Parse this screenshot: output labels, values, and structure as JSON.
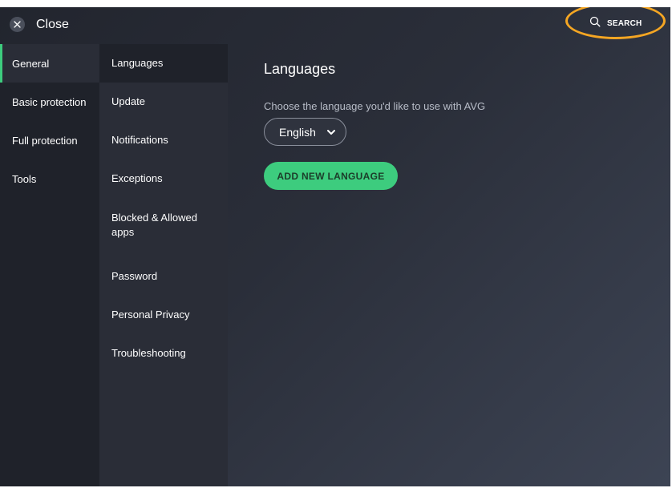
{
  "header": {
    "close_label": "Close",
    "search_label": "SEARCH"
  },
  "nav_primary": {
    "items": [
      {
        "label": "General",
        "active": true
      },
      {
        "label": "Basic protection",
        "active": false
      },
      {
        "label": "Full protection",
        "active": false
      },
      {
        "label": "Tools",
        "active": false
      }
    ]
  },
  "nav_secondary": {
    "items": [
      {
        "label": "Languages",
        "active": true
      },
      {
        "label": "Update",
        "active": false
      },
      {
        "label": "Notifications",
        "active": false
      },
      {
        "label": "Exceptions",
        "active": false
      },
      {
        "label": "Blocked & Allowed apps",
        "active": false
      },
      {
        "label": "Password",
        "active": false
      },
      {
        "label": "Personal Privacy",
        "active": false
      },
      {
        "label": "Troubleshooting",
        "active": false
      }
    ]
  },
  "content": {
    "title": "Languages",
    "description": "Choose the language you'd like to use with AVG",
    "language_select": {
      "selected": "English"
    },
    "add_button_label": "ADD NEW LANGUAGE"
  },
  "colors": {
    "accent_green": "#3dcc7e",
    "highlight_orange": "#f5a623",
    "nav_dark": "#1f222a",
    "nav_mid": "#2a2d37"
  },
  "icons": {
    "close": "close-icon",
    "search": "search-icon",
    "dropdown": "chevron-down-icon"
  }
}
